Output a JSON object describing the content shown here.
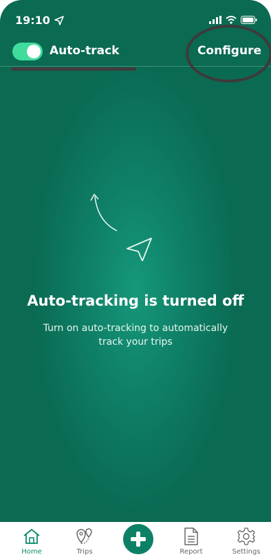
{
  "status": {
    "time": "19:10",
    "location_icon": "location-arrow-icon",
    "icons": [
      "signal-icon",
      "wifi-icon",
      "battery-icon"
    ]
  },
  "header": {
    "toggle_on": true,
    "toggle_label": "Auto-track",
    "configure_label": "Configure"
  },
  "empty_state": {
    "title": "Auto-tracking is turned off",
    "subtitle": "Turn on auto-tracking to automatically track your trips"
  },
  "tabbar": {
    "home": "Home",
    "trips": "Trips",
    "add": "add-trip",
    "report": "Report",
    "settings": "Settings"
  },
  "colors": {
    "primary": "#0f8168",
    "toggle": "#3fdc9c",
    "active_tab": "#0c8a6b"
  }
}
